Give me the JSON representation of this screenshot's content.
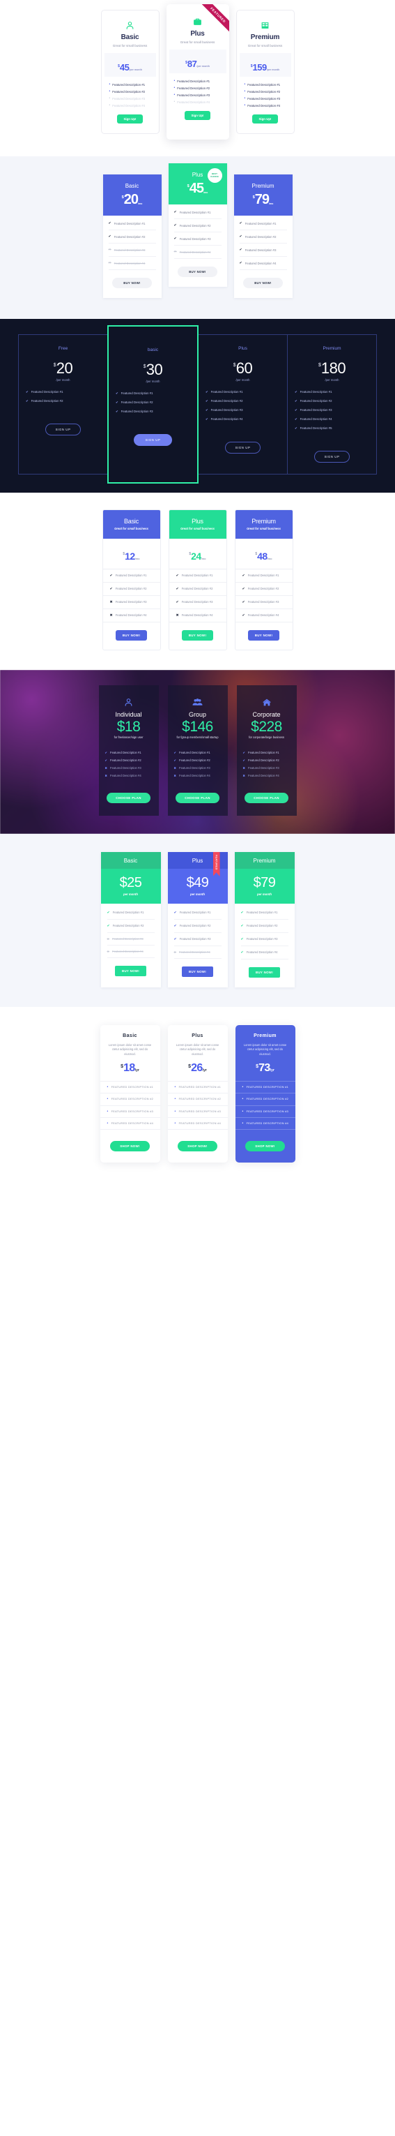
{
  "colors": {
    "green": "#23dd96",
    "blue": "#4f63e0",
    "indigo": "#4a5bed",
    "dark_navy": "#0f1426",
    "mint": "#2ff0a8",
    "crimson": "#c2185b",
    "red": "#f2495c"
  },
  "section1": {
    "ribbon_label": "FEATURED",
    "cards": [
      {
        "icon": "user-icon",
        "name": "Basic",
        "tagline": "Great for small business",
        "currency": "$",
        "amount": "45",
        "period": "/per month",
        "features": [
          {
            "text": "Featured Description #1",
            "enabled": true
          },
          {
            "text": "Featured Description #2",
            "enabled": true
          },
          {
            "text": "Featured Description #3",
            "enabled": false
          },
          {
            "text": "Featured Description #4",
            "enabled": false
          }
        ],
        "cta": "Sign Up!"
      },
      {
        "icon": "briefcase-icon",
        "name": "Plus",
        "tagline": "Great for small business",
        "currency": "$",
        "amount": "87",
        "period": "/per month",
        "features": [
          {
            "text": "Featured Description #1",
            "enabled": true
          },
          {
            "text": "Featured Description #2",
            "enabled": true
          },
          {
            "text": "Featured Description #3",
            "enabled": true
          },
          {
            "text": "Featured Description #4",
            "enabled": false
          }
        ],
        "cta": "Sign Up!"
      },
      {
        "icon": "grid-icon",
        "name": "Premium",
        "tagline": "Great for small business",
        "currency": "$",
        "amount": "159",
        "period": "/per month",
        "features": [
          {
            "text": "Featured Description #1",
            "enabled": true
          },
          {
            "text": "Featured Description #2",
            "enabled": true
          },
          {
            "text": "Featured Description #3",
            "enabled": true
          },
          {
            "text": "Featured Description #4",
            "enabled": true
          }
        ],
        "cta": "Sign Up!"
      }
    ]
  },
  "section2": {
    "badge_line1": "BEST",
    "badge_line2": "CHOICE",
    "cards": [
      {
        "name": "Basic",
        "currency": "$",
        "amount": "20",
        "period": "/mo",
        "theme": "blue",
        "features": [
          {
            "text": "Featured Description #1",
            "enabled": true
          },
          {
            "text": "Featured Description #2",
            "enabled": true
          },
          {
            "text": "Featured Description #3",
            "enabled": false
          },
          {
            "text": "Featured Description #4",
            "enabled": false
          }
        ],
        "cta": "BUY NOW!"
      },
      {
        "name": "Plus",
        "currency": "$",
        "amount": "45",
        "period": "/mo",
        "theme": "green",
        "features": [
          {
            "text": "Featured Description #1",
            "enabled": true
          },
          {
            "text": "Featured Description #2",
            "enabled": true
          },
          {
            "text": "Featured Description #3",
            "enabled": true
          },
          {
            "text": "Featured Description #4",
            "enabled": false
          }
        ],
        "cta": "BUY NOW!"
      },
      {
        "name": "Premium",
        "currency": "$",
        "amount": "79",
        "period": "/mo",
        "theme": "blue",
        "features": [
          {
            "text": "Featured Description #1",
            "enabled": true
          },
          {
            "text": "Featured Description #2",
            "enabled": true
          },
          {
            "text": "Featured Description #3",
            "enabled": true
          },
          {
            "text": "Featured Description #4",
            "enabled": true
          }
        ],
        "cta": "BUY NOW!"
      }
    ]
  },
  "section3": {
    "columns": [
      {
        "name": "Free",
        "currency": "$",
        "amount": "20",
        "period": "/per month",
        "highlighted": false,
        "features": [
          "Featured Description #1",
          "Featured Description #2"
        ],
        "cta": "SIGN UP"
      },
      {
        "name": "basic",
        "currency": "$",
        "amount": "30",
        "period": "/per month",
        "highlighted": true,
        "features": [
          "Featured Description #1",
          "Featured Description #2",
          "Featured Description #3"
        ],
        "cta": "SIGN UP"
      },
      {
        "name": "Plus",
        "currency": "$",
        "amount": "60",
        "period": "/per month",
        "highlighted": false,
        "features": [
          "Featured Description #1",
          "Featured Description #2",
          "Featured Description #3",
          "Featured Description #4"
        ],
        "cta": "SIGN UP"
      },
      {
        "name": "Premium",
        "currency": "$",
        "amount": "180",
        "period": "/per month",
        "highlighted": false,
        "features": [
          "Featured Description #1",
          "Featured Description #2",
          "Featured Description #3",
          "Featured Description #4",
          "Featured Description #5"
        ],
        "cta": "SIGN UP"
      }
    ]
  },
  "section4": {
    "cards": [
      {
        "name": "Basic",
        "tagline": "Great for small business",
        "theme": "blue",
        "currency": "$",
        "amount": "12",
        "period": "/mo",
        "features": [
          {
            "text": "Featured Description #1",
            "enabled": true
          },
          {
            "text": "Featured Description #2",
            "enabled": true
          },
          {
            "text": "Featured Description #3",
            "enabled": false
          },
          {
            "text": "Featured Description #4",
            "enabled": false
          }
        ],
        "cta": "BUY NOW!"
      },
      {
        "name": "Plus",
        "tagline": "Great for small business",
        "theme": "green",
        "currency": "$",
        "amount": "24",
        "period": "/mo",
        "features": [
          {
            "text": "Featured Description #1",
            "enabled": true
          },
          {
            "text": "Featured Description #2",
            "enabled": true
          },
          {
            "text": "Featured Description #3",
            "enabled": true
          },
          {
            "text": "Featured Description #4",
            "enabled": false
          }
        ],
        "cta": "BUY NOW!"
      },
      {
        "name": "Premium",
        "tagline": "Great for small business",
        "theme": "blue",
        "currency": "$",
        "amount": "48",
        "period": "/mo",
        "features": [
          {
            "text": "Featured Description #1",
            "enabled": true
          },
          {
            "text": "Featured Description #2",
            "enabled": true
          },
          {
            "text": "Featured Description #3",
            "enabled": true
          },
          {
            "text": "Featured Description #4",
            "enabled": true
          }
        ],
        "cta": "BUY NOW!"
      }
    ]
  },
  "section5": {
    "cards": [
      {
        "icon": "user-icon",
        "name": "Individual",
        "price": "$18",
        "subtitle": "for freelancer/sign user",
        "features": [
          {
            "text": "Featured Description #1",
            "enabled": true
          },
          {
            "text": "Featured Description #2",
            "enabled": true
          },
          {
            "text": "Featured Description #3",
            "enabled": false
          },
          {
            "text": "Featured Description #4",
            "enabled": false
          }
        ],
        "cta": "CHOOSE PLAN"
      },
      {
        "icon": "group-icon",
        "name": "Group",
        "price": "$146",
        "subtitle": "for fgroup members/small startup",
        "features": [
          {
            "text": "Featured Description #1",
            "enabled": true
          },
          {
            "text": "Featured Description #2",
            "enabled": true
          },
          {
            "text": "Featured Description #3",
            "enabled": false
          },
          {
            "text": "Featured Description #4",
            "enabled": false
          }
        ],
        "cta": "CHOOSE PLAN"
      },
      {
        "icon": "home-icon",
        "name": "Corporate",
        "price": "$228",
        "subtitle": "for corporate/large business",
        "features": [
          {
            "text": "Featured Description #1",
            "enabled": true
          },
          {
            "text": "Featured Description #2",
            "enabled": true
          },
          {
            "text": "Featured Description #3",
            "enabled": false
          },
          {
            "text": "Featured Description #4",
            "enabled": false
          }
        ],
        "cta": "CHOOSE PLAN"
      }
    ]
  },
  "section6": {
    "ribbon_label": "FEATURED",
    "cards": [
      {
        "name": "Basic",
        "theme": "green",
        "price": "$25",
        "period": "per month",
        "features": [
          {
            "text": "Featured Description #1",
            "enabled": true
          },
          {
            "text": "Featured Description #2",
            "enabled": true
          },
          {
            "text": "Featured Description #3",
            "enabled": false
          },
          {
            "text": "Featured Description #4",
            "enabled": false
          }
        ],
        "cta": "BUY NOW!"
      },
      {
        "name": "Plus",
        "theme": "blue",
        "price": "$49",
        "period": "per month",
        "features": [
          {
            "text": "Featured Description #1",
            "enabled": true
          },
          {
            "text": "Featured Description #2",
            "enabled": true
          },
          {
            "text": "Featured Description #3",
            "enabled": true
          },
          {
            "text": "Featured Description #4",
            "enabled": false
          }
        ],
        "cta": "BUY NOW!"
      },
      {
        "name": "Premium",
        "theme": "green",
        "price": "$79",
        "period": "per month",
        "features": [
          {
            "text": "Featured Description #1",
            "enabled": true
          },
          {
            "text": "Featured Description #2",
            "enabled": true
          },
          {
            "text": "Featured Description #3",
            "enabled": true
          },
          {
            "text": "Featured Description #4",
            "enabled": true
          }
        ],
        "cta": "BUY NOW!"
      }
    ]
  },
  "section7": {
    "cards": [
      {
        "name": "Basic",
        "highlighted": false,
        "description": "Lorem ipsum dolor sit amet conse ctetur adipisicing elit, sed do eiusmod.",
        "currency": "$",
        "amount": "18",
        "period": "/yr",
        "features": [
          "FEATURED DESCRIPTION #1",
          "FEATURED DESCRIPTION #2",
          "FEATURED DESCRIPTION #3",
          "FEATURED DESCRIPTION #4"
        ],
        "cta": "SHOP NOW!"
      },
      {
        "name": "Plus",
        "highlighted": false,
        "description": "Lorem ipsum dolor sit amet conse ctetur adipisicing elit, sed do eiusmod.",
        "currency": "$",
        "amount": "26",
        "period": "/yr",
        "features": [
          "FEATURED DESCRIPTION #1",
          "FEATURED DESCRIPTION #2",
          "FEATURED DESCRIPTION #3",
          "FEATURED DESCRIPTION #4"
        ],
        "cta": "SHOP NOW!"
      },
      {
        "name": "Premium",
        "highlighted": true,
        "description": "Lorem ipsum dolor sit amet conse ctetur adipisicing elit, sed do eiusmod.",
        "currency": "$",
        "amount": "73",
        "period": "/yr",
        "features": [
          "FEATURED DESCRIPTION #1",
          "FEATURED DESCRIPTION #2",
          "FEATURED DESCRIPTION #3",
          "FEATURED DESCRIPTION #4"
        ],
        "cta": "SHOP NOW!"
      }
    ]
  }
}
